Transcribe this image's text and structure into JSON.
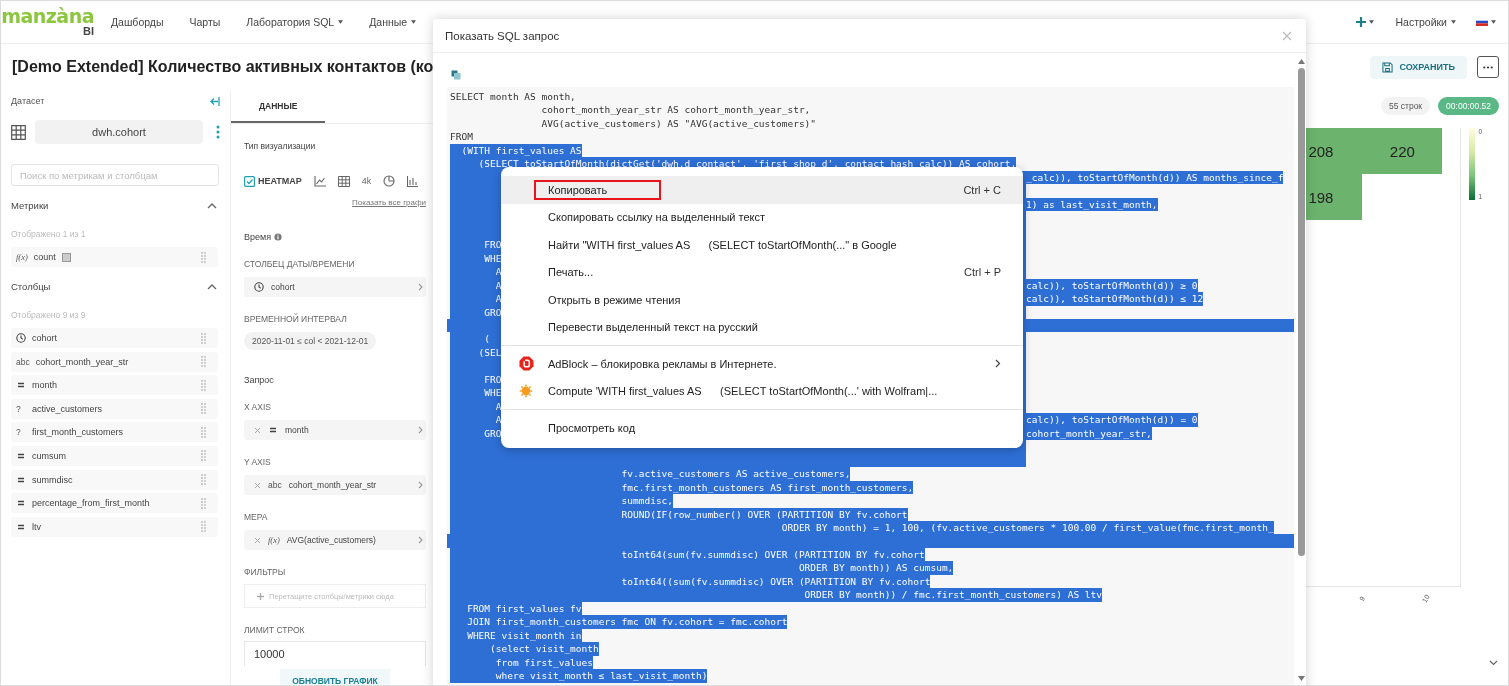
{
  "nav": {
    "logo": "manzàna",
    "logo_sub": "BI",
    "items": [
      {
        "label": "Дашборды",
        "dropdown": false
      },
      {
        "label": "Чарты",
        "dropdown": false
      },
      {
        "label": "Лаборатория SQL",
        "dropdown": true
      },
      {
        "label": "Данные",
        "dropdown": true
      }
    ],
    "settings": "Настройки"
  },
  "title": "[Demo Extended] Количество активных контактов (ко",
  "toolbar": {
    "save": "СОХРАНИТЬ"
  },
  "dataset": {
    "label": "Датасет",
    "name": "dwh.cohort",
    "search_placeholder": "Поиск по метрикам и столбцам"
  },
  "metrics": {
    "title": "Метрики",
    "expanded": true,
    "count": "Отображено 1 из 1",
    "items": [
      {
        "name": "count",
        "kind": "metric",
        "type_label": "f(x)"
      }
    ]
  },
  "columns": {
    "title": "Столбцы",
    "expanded": true,
    "count": "Отображено 9 из 9",
    "items": [
      {
        "name": "cohort",
        "kind": "time"
      },
      {
        "name": "cohort_month_year_str",
        "kind": "string",
        "type_label": "abc"
      },
      {
        "name": "month",
        "kind": "number"
      },
      {
        "name": "active_customers",
        "kind": "unknown",
        "type_label": "?"
      },
      {
        "name": "first_month_customers",
        "kind": "unknown",
        "type_label": "?"
      },
      {
        "name": "cumsum",
        "kind": "number"
      },
      {
        "name": "summdisc",
        "kind": "number"
      },
      {
        "name": "percentage_from_first_month",
        "kind": "number"
      },
      {
        "name": "ltv",
        "kind": "number"
      }
    ]
  },
  "tabs": [
    {
      "label": "ДАННЫЕ",
      "selected": true
    }
  ],
  "viz": {
    "label": "Тип визуализации",
    "types": [
      {
        "kind": "heatmap",
        "label": "HEATMAP",
        "selected": true
      },
      {
        "kind": "line",
        "selected": false
      },
      {
        "kind": "table",
        "selected": false
      },
      {
        "kind": "big_number",
        "label": "4k",
        "selected": false
      },
      {
        "kind": "pie",
        "selected": false
      },
      {
        "kind": "bar",
        "selected": false
      }
    ],
    "show_all": "Показать все графи"
  },
  "time": {
    "label": "Время",
    "column_label": "СТОЛБЕЦ ДАТЫ/ВРЕМЕНИ",
    "column": "cohort",
    "interval_label": "ВРЕМЕННОЙ ИНТЕРВАЛ",
    "interval": "2020-11-01 ≤ col < 2021-12-01"
  },
  "query": {
    "label": "Запрос",
    "fields": [
      {
        "label": "X AXIS",
        "kind": "number",
        "value": "month"
      },
      {
        "label": "Y AXIS",
        "kind": "string",
        "type_label": "abc",
        "value": "cohort_month_year_str"
      },
      {
        "label": "МЕРА",
        "kind": "metric",
        "type_label": "f(x)",
        "value": "AVG(active_customers)"
      }
    ],
    "filters_label": "ФИЛЬТРЫ",
    "filters_placeholder": "Перетащите столбцы/метрики сюда",
    "limit_label": "ЛИМИТ СТРОК",
    "limit": "10000",
    "update": "ОБНОВИТЬ ГРАФИК"
  },
  "result": {
    "rows": "55 строк",
    "time": "00:00:00.52",
    "heatmap": {
      "rows": [
        [
          "208",
          "220"
        ],
        [
          "198"
        ]
      ],
      "x_labels": [
        "9",
        "10"
      ],
      "legend": [
        "0",
        "1"
      ]
    }
  },
  "modal": {
    "title": "Показать SQL запрос",
    "lines": [
      {
        "kind": "plain",
        "text": "SELECT month AS month,",
        "selected": false
      },
      {
        "kind": "plain",
        "text": "                cohort_month_year_str AS cohort_month_year_str,",
        "selected": false
      },
      {
        "kind": "plain",
        "text": "                AVG(active_customers) AS \"AVG(active_customers)\"",
        "selected": false
      },
      {
        "kind": "plain",
        "text": "FROM",
        "selected": false
      },
      {
        "kind": "plain",
        "text": "  (WITH first_values AS",
        "selected": true
      },
      {
        "kind": "plain",
        "text": "     (SELECT toStartOfMonth(dictGet('dwh.d_contact', 'first_shop_d', contact_hash_calc)) AS cohort,",
        "selected": true
      },
      {
        "kind": "covered",
        "selected": true,
        "tail": "_calc)), toStartOfMonth(d)) AS months_since_f"
      },
      {
        "kind": "covered",
        "selected": true
      },
      {
        "kind": "covered",
        "selected": true,
        "tail": "1) as last_visit_month,"
      },
      {
        "kind": "covered",
        "selected": true
      },
      {
        "kind": "covered",
        "selected": true
      },
      {
        "kind": "covered",
        "text": "      FRO",
        "selected": true
      },
      {
        "kind": "covered",
        "text": "      WHE",
        "selected": true
      },
      {
        "kind": "covered",
        "text": "        A",
        "selected": true
      },
      {
        "kind": "covered",
        "text": "        A",
        "selected": true,
        "tail": "calc)), toStartOfMonth(d)) ≥ 0"
      },
      {
        "kind": "covered",
        "text": "        A",
        "selected": true,
        "tail": "calc)), toStartOfMonth(d)) ≤ 12"
      },
      {
        "kind": "covered",
        "text": "      GRO",
        "selected": true
      },
      {
        "kind": "full",
        "selected": true
      },
      {
        "kind": "covered",
        "text": "      (",
        "selected": true
      },
      {
        "kind": "covered",
        "text": "     (SEL",
        "selected": true
      },
      {
        "kind": "covered",
        "selected": true
      },
      {
        "kind": "covered",
        "text": "      FRO",
        "selected": true
      },
      {
        "kind": "covered",
        "text": "      WHE",
        "selected": true
      },
      {
        "kind": "covered",
        "text": "        A",
        "selected": true
      },
      {
        "kind": "covered",
        "text": "        A",
        "selected": true,
        "tail": "calc)), toStartOfMonth(d)) = 0"
      },
      {
        "kind": "covered",
        "text": "      GRO",
        "selected": true,
        "tail": "cohort_month_year_str,"
      },
      {
        "kind": "covered",
        "selected": true
      },
      {
        "kind": "covered",
        "selected": true
      },
      {
        "kind": "plain",
        "text": "                              fv.active_customers AS active_customers,",
        "selected": true
      },
      {
        "kind": "plain",
        "text": "                              fmc.first_month_customers AS first_month_customers,",
        "selected": true
      },
      {
        "kind": "plain",
        "text": "                              summdisc,",
        "selected": true
      },
      {
        "kind": "plain",
        "text": "                              ROUND(IF(row_number() OVER (PARTITION BY fv.cohort",
        "selected": true
      },
      {
        "kind": "plain",
        "text": "                                                          ORDER BY month) = 1, 100, (fv.active_customers * 100.00 / first_value(fmc.first_month_",
        "selected": true
      },
      {
        "kind": "full",
        "selected": true
      },
      {
        "kind": "plain",
        "text": "                              toInt64(sum(fv.summdisc) OVER (PARTITION BY fv.cohort",
        "selected": true
      },
      {
        "kind": "plain",
        "text": "                                                             ORDER BY month)) AS cumsum,",
        "selected": true
      },
      {
        "kind": "plain",
        "text": "                              toInt64((sum(fv.summdisc) OVER (PARTITION BY fv.cohort",
        "selected": true
      },
      {
        "kind": "plain",
        "text": "                                                              ORDER BY month)) / fmc.first_month_customers) AS ltv",
        "selected": true
      },
      {
        "kind": "plain",
        "text": "   FROM first_values fv",
        "selected": true
      },
      {
        "kind": "plain",
        "text": "   JOIN first_month_customers fmc ON fv.cohort = fmc.cohort",
        "selected": true
      },
      {
        "kind": "plain",
        "text": "   WHERE visit_month in",
        "selected": true
      },
      {
        "kind": "plain",
        "text": "       (select visit_month",
        "selected": true
      },
      {
        "kind": "plain",
        "text": "        from first_values",
        "selected": true
      },
      {
        "kind": "plain",
        "text": "        where visit_month ≤ last_visit_month)",
        "selected": true
      }
    ],
    "menu": [
      [
        {
          "label": "Копировать",
          "shortcut": "Ctrl + C",
          "selected": true,
          "annotated": true,
          "submenu": false
        },
        {
          "label": "Скопировать ссылку на выделенный текст",
          "selected": false,
          "annotated": false,
          "submenu": false
        },
        {
          "label": "Найти \"WITH first_values AS      (SELECT toStartOfMonth(...\" в Google",
          "selected": false,
          "annotated": false,
          "submenu": false
        },
        {
          "label": "Печать...",
          "shortcut": "Ctrl + P",
          "selected": false,
          "annotated": false,
          "submenu": false
        },
        {
          "label": "Открыть в режиме чтения",
          "selected": false,
          "annotated": false,
          "submenu": false
        },
        {
          "label": "Перевести выделенный текст на русский",
          "selected": false,
          "annotated": false,
          "submenu": false
        }
      ],
      [
        {
          "label": "AdBlock – блокировка рекламы в Интернете.",
          "kind": "extension_block",
          "selected": false,
          "annotated": false,
          "submenu": true
        },
        {
          "label": "Compute 'WITH first_values AS      (SELECT toStartOfMonth(...' with Wolfram|...",
          "kind": "extension_compute",
          "selected": false,
          "annotated": false,
          "submenu": false
        }
      ],
      [
        {
          "label": "Просмотреть код",
          "selected": false,
          "annotated": false,
          "submenu": false
        }
      ]
    ]
  }
}
